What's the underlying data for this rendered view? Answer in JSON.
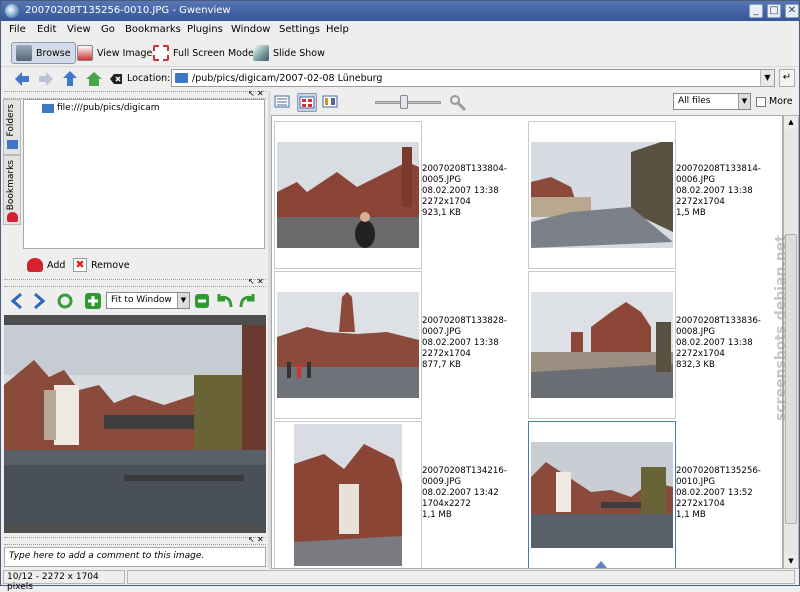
{
  "window": {
    "title": "20070208T135256-0010.JPG - Gwenview"
  },
  "menu": [
    "File",
    "Edit",
    "View",
    "Go",
    "Bookmarks",
    "Plugins",
    "Window",
    "Settings",
    "Help"
  ],
  "toolbar": {
    "browse": "Browse",
    "view_image": "View Image",
    "full_screen": "Full Screen Mode",
    "slide_show": "Slide Show"
  },
  "location": {
    "label": "Location:",
    "value": "/pub/pics/digicam/2007-02-08 Lüneburg"
  },
  "sidebar": {
    "tabs": [
      "Folders",
      "Bookmarks"
    ],
    "tree_item": "file:///pub/pics/digicam",
    "add": "Add",
    "remove": "Remove"
  },
  "image_tools": {
    "zoom_mode": "Fit to Window"
  },
  "comment": {
    "placeholder": "Type here to add a comment to this image."
  },
  "filter": {
    "value": "All files",
    "more": "More"
  },
  "thumbnails": [
    {
      "name": "20070208T133804-",
      "name2": "0005.JPG",
      "date": "08.02.2007 13:38",
      "dims": "2272x1704",
      "size": "923,1 KB"
    },
    {
      "name": "20070208T133814-",
      "name2": "0006.JPG",
      "date": "08.02.2007 13:38",
      "dims": "2272x1704",
      "size": "1,5 MB"
    },
    {
      "name": "20070208T133828-",
      "name2": "0007.JPG",
      "date": "08.02.2007 13:38",
      "dims": "2272x1704",
      "size": "877,7 KB"
    },
    {
      "name": "20070208T133836-",
      "name2": "0008.JPG",
      "date": "08.02.2007 13:38",
      "dims": "2272x1704",
      "size": "832,3 KB"
    },
    {
      "name": "20070208T134216-",
      "name2": "0009.JPG",
      "date": "08.02.2007 13:42",
      "dims": "1704x2272",
      "size": "1,1 MB"
    },
    {
      "name": "20070208T135256-",
      "name2": "0010.JPG",
      "date": "08.02.2007 13:52",
      "dims": "2272x1704",
      "size": "1,1 MB"
    }
  ],
  "status": {
    "text": "10/12 - 2272 x 1704 pixels"
  },
  "watermark": "screenshots.debian.net"
}
